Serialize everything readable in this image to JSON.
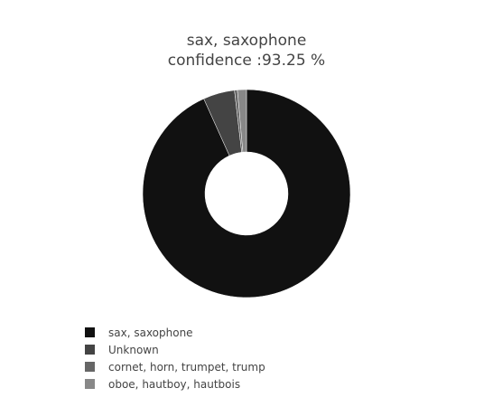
{
  "title": {
    "line1": "sax, saxophone",
    "line2": "confidence :93.25 %"
  },
  "chart_data": {
    "type": "pie",
    "hole": 0.4,
    "start": "top",
    "direction": "clockwise",
    "categories": [
      "sax, saxophone",
      "Unknown",
      "cornet, horn, trumpet, trump",
      "oboe, hautboy, hautbois"
    ],
    "values": [
      93.25,
      4.9,
      0.45,
      1.4
    ],
    "colors": [
      "#111111",
      "#444444",
      "#666666",
      "#888888"
    ],
    "legend_position": "bottom-left"
  }
}
